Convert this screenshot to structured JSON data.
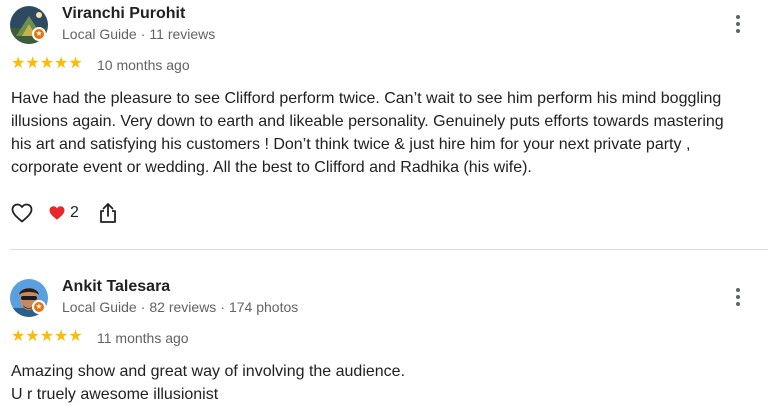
{
  "reviews": [
    {
      "name": "Viranchi Purohit",
      "guide_label": "Local Guide",
      "reviews_count": "11 reviews",
      "photos_count": "",
      "rating": 5,
      "stars": "★★★★★",
      "date": "10 months ago",
      "text": "Have had the pleasure to see Clifford perform twice. Can’t wait to see him perform his mind boggling\nillusions again. Very down to earth and likeable personality. Genuinely puts efforts towards mastering\nhis art and satisfying his customers ! Don’t think twice & just hire him for your next private party ,\ncorporate event or wedding. All the best to Clifford and Radhika (his wife).",
      "reactions": {
        "heart_count": "2"
      }
    },
    {
      "name": "Ankit Talesara",
      "guide_label": "Local Guide",
      "reviews_count": "82 reviews",
      "photos_count": "174 photos",
      "rating": 5,
      "stars": "★★★★★",
      "date": "11 months ago",
      "text": "Amazing show and great way of involving the audience.\nU r truely awesome illusionist"
    }
  ],
  "icons": {
    "like": "heart-outline-icon",
    "reaction": "red-heart-icon",
    "share": "share-icon",
    "more": "more-vert-icon",
    "badge": "local-guide-badge-icon"
  },
  "colors": {
    "star": "#fbbc04",
    "badge": "#e8710a",
    "meta_text": "#5f6368",
    "divider": "#dadce0",
    "heart": "#e8272c"
  }
}
